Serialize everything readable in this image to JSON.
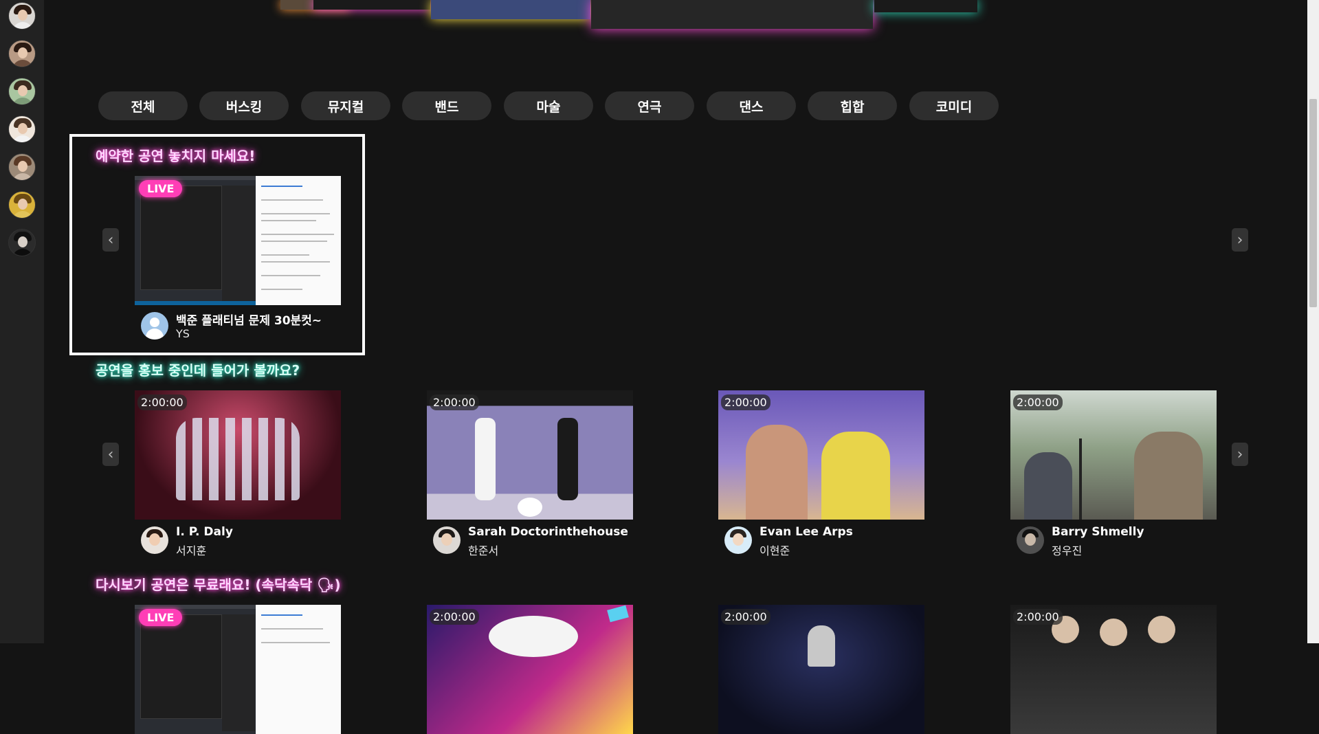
{
  "categories": [
    "전체",
    "버스킹",
    "뮤지컬",
    "밴드",
    "마술",
    "연극",
    "댄스",
    "힙합",
    "코미디"
  ],
  "sections": {
    "reserved": {
      "title": "예약한 공연 놓치지 마세요!",
      "cards": [
        {
          "badge": "LIVE",
          "title": "백준 플래티넘 문제 30분컷~",
          "subtitle": "YS"
        }
      ]
    },
    "promo": {
      "title": "공연을 홍보 중인데 들어가 볼까요?",
      "cards": [
        {
          "badge": "2:00:00",
          "title": "I. P. Daly",
          "subtitle": "서지훈"
        },
        {
          "badge": "2:00:00",
          "title": "Sarah Doctorinthehouse",
          "subtitle": "한준서"
        },
        {
          "badge": "2:00:00",
          "title": "Evan Lee Arps",
          "subtitle": "이현준"
        },
        {
          "badge": "2:00:00",
          "title": "Barry Shmelly",
          "subtitle": "정우진"
        }
      ]
    },
    "replay": {
      "title": "다시보기 공연은 무료래요! (속닥속닥 🗣)",
      "cards": [
        {
          "badge": "LIVE"
        },
        {
          "badge": "2:00:00"
        },
        {
          "badge": "2:00:00"
        },
        {
          "badge": "2:00:00"
        }
      ]
    }
  },
  "arrows": {
    "prev": "‹",
    "next": "›"
  },
  "colors": {
    "background": "#141414",
    "sidebar": "#222222",
    "live_badge": "#ff3eb6",
    "pink_glow": "#ff4fd8",
    "cyan_glow": "#2fe0c0",
    "category_button": "#2e2e2e"
  }
}
